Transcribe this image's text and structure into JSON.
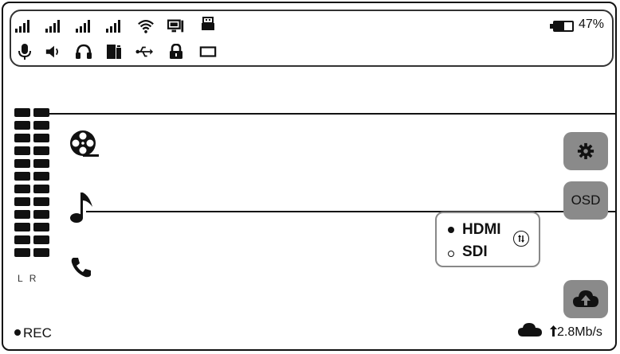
{
  "status": {
    "battery_percent_label": "47%"
  },
  "meter": {
    "left_label": "L",
    "right_label": "R"
  },
  "buttons": {
    "osd_label": "OSD"
  },
  "source": {
    "options": [
      "HDMI",
      "SDI"
    ],
    "selected": "HDMI"
  },
  "bottom": {
    "rec_label": "REC",
    "upload_rate": "2.8Mb/s"
  },
  "icons": {
    "status_row1": [
      "signal-bars-icon",
      "signal-bars-icon",
      "signal-bars-icon",
      "signal-bars-icon",
      "wifi-icon",
      "monitor-icon",
      "usb-drive-icon"
    ],
    "status_row2": [
      "microphone-icon",
      "speaker-icon",
      "headphones-icon",
      "sd-card-icon",
      "usb-icon",
      "lock-icon",
      "rectangle-icon"
    ],
    "left_column": [
      "film-reel-icon",
      "music-note-icon",
      "phone-icon"
    ]
  }
}
